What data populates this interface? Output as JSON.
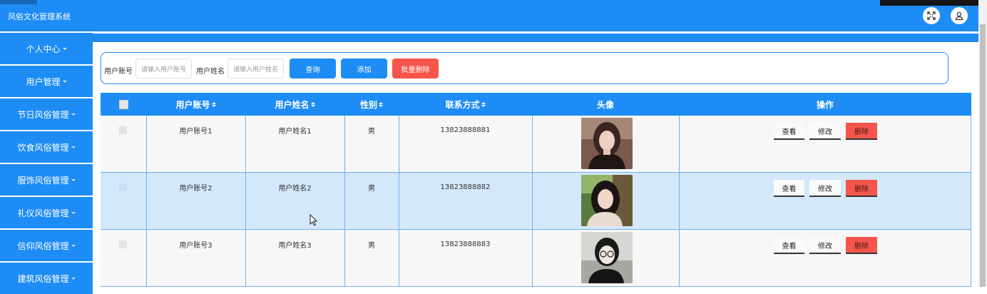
{
  "app": {
    "title": "风俗文化管理系统"
  },
  "header": {
    "fullscreen_icon": "fullscreen-icon",
    "user_icon": "user-icon"
  },
  "sidebar": {
    "items": [
      {
        "label": "个人中心"
      },
      {
        "label": "用户管理"
      },
      {
        "label": "节日风俗管理"
      },
      {
        "label": "饮食风俗管理"
      },
      {
        "label": "服饰风俗管理"
      },
      {
        "label": "礼仪风俗管理"
      },
      {
        "label": "信仰风俗管理"
      },
      {
        "label": "建筑风俗管理"
      }
    ]
  },
  "search": {
    "account_label": "用户账号",
    "account_placeholder": "请输入用户账号",
    "name_label": "用户姓名",
    "name_placeholder": "请输入用户姓名",
    "query_label": "查询",
    "add_label": "添加",
    "batch_delete_label": "批量删除"
  },
  "table": {
    "columns": [
      "用户账号",
      "用户姓名",
      "性别",
      "联系方式",
      "头像",
      "操作"
    ],
    "rows": [
      {
        "account": "用户账号1",
        "name": "用户姓名1",
        "gender": "男",
        "phone": "13823888881"
      },
      {
        "account": "用户账号2",
        "name": "用户姓名2",
        "gender": "男",
        "phone": "13823888882"
      },
      {
        "account": "用户账号3",
        "name": "用户姓名3",
        "gender": "男",
        "phone": "13823888883"
      }
    ],
    "actions": {
      "view": "查看",
      "edit": "修改",
      "delete": "删除"
    }
  },
  "colors": {
    "primary": "#1e8cf5",
    "danger": "#f5554a",
    "highlight_row": "#d4e8fc"
  }
}
